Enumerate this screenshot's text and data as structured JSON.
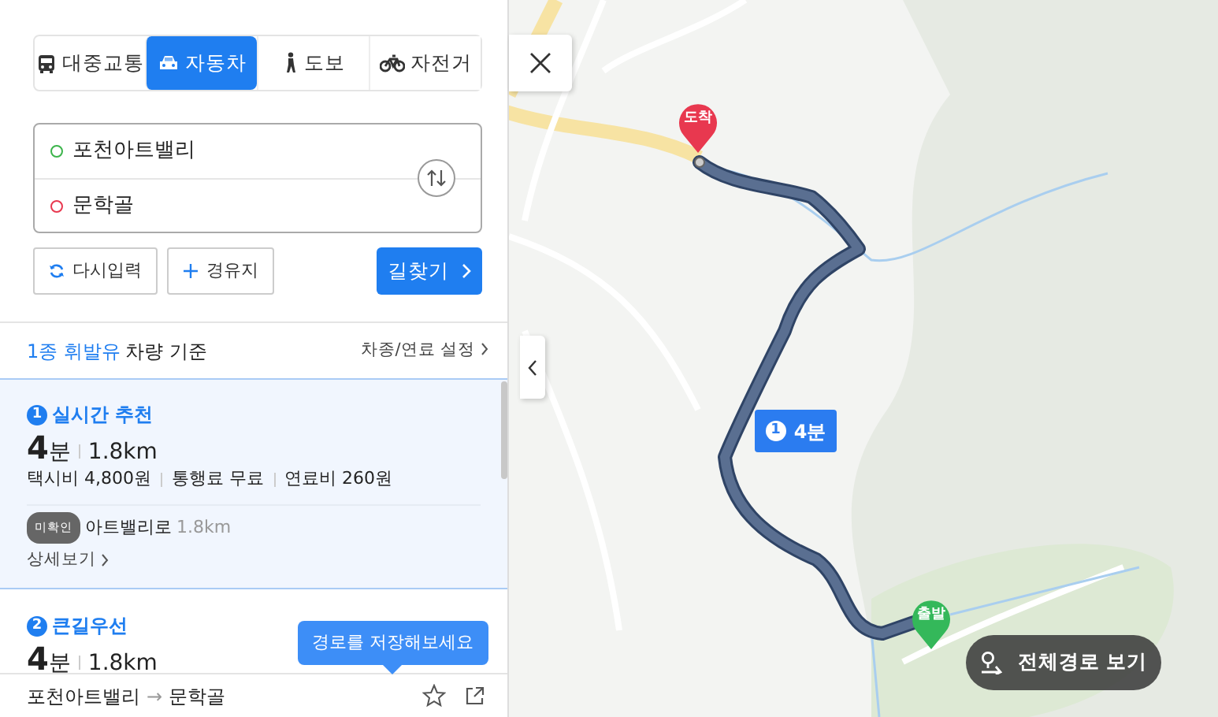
{
  "transport_tabs": [
    {
      "label": "대중교통",
      "kind": "bus",
      "selected": false
    },
    {
      "label": "자동차",
      "kind": "car",
      "selected": true
    },
    {
      "label": "도보",
      "kind": "walk",
      "selected": false
    },
    {
      "label": "자전거",
      "kind": "bike",
      "selected": false
    }
  ],
  "route_inputs": [
    {
      "value": "포천아트밸리",
      "kind": "origin"
    },
    {
      "value": "문학골",
      "kind": "destination"
    }
  ],
  "actions": [
    {
      "label": "다시입력",
      "kind": "reset"
    },
    {
      "label": "경유지",
      "kind": "waypoint"
    }
  ],
  "search_button": {
    "label": "길찾기"
  },
  "vehicle_basis": {
    "fuel": "1종 휘발유",
    "suffix": "차량 기준",
    "settings_link": "차종/연료 설정"
  },
  "routes": [
    {
      "number": "1",
      "title": "실시간 추천",
      "minutes": "4",
      "minutes_unit": "분",
      "distance": "1.8km",
      "costs": [
        "택시비 4,800원",
        "통행료 무료",
        "연료비 260원"
      ],
      "road_badge": "미확인",
      "road_name": "아트밸리로",
      "road_distance": "1.8km",
      "detail_link": "상세보기",
      "selected": true
    },
    {
      "number": "2",
      "title": "큰길우선",
      "minutes": "4",
      "minutes_unit": "분",
      "distance": "1.8km",
      "selected": false
    }
  ],
  "tooltip": "경로를 저장해보세요",
  "footer": {
    "origin": "포천아트밸리",
    "arrow": "→",
    "destination": "문학골"
  },
  "map": {
    "kind": "picture",
    "markers": [
      {
        "label": "도착",
        "kind": "destination"
      },
      {
        "label": "출발",
        "kind": "origin"
      }
    ],
    "route_label": {
      "number": "1",
      "time": "4분"
    },
    "overview_button": "전체경로 보기"
  }
}
